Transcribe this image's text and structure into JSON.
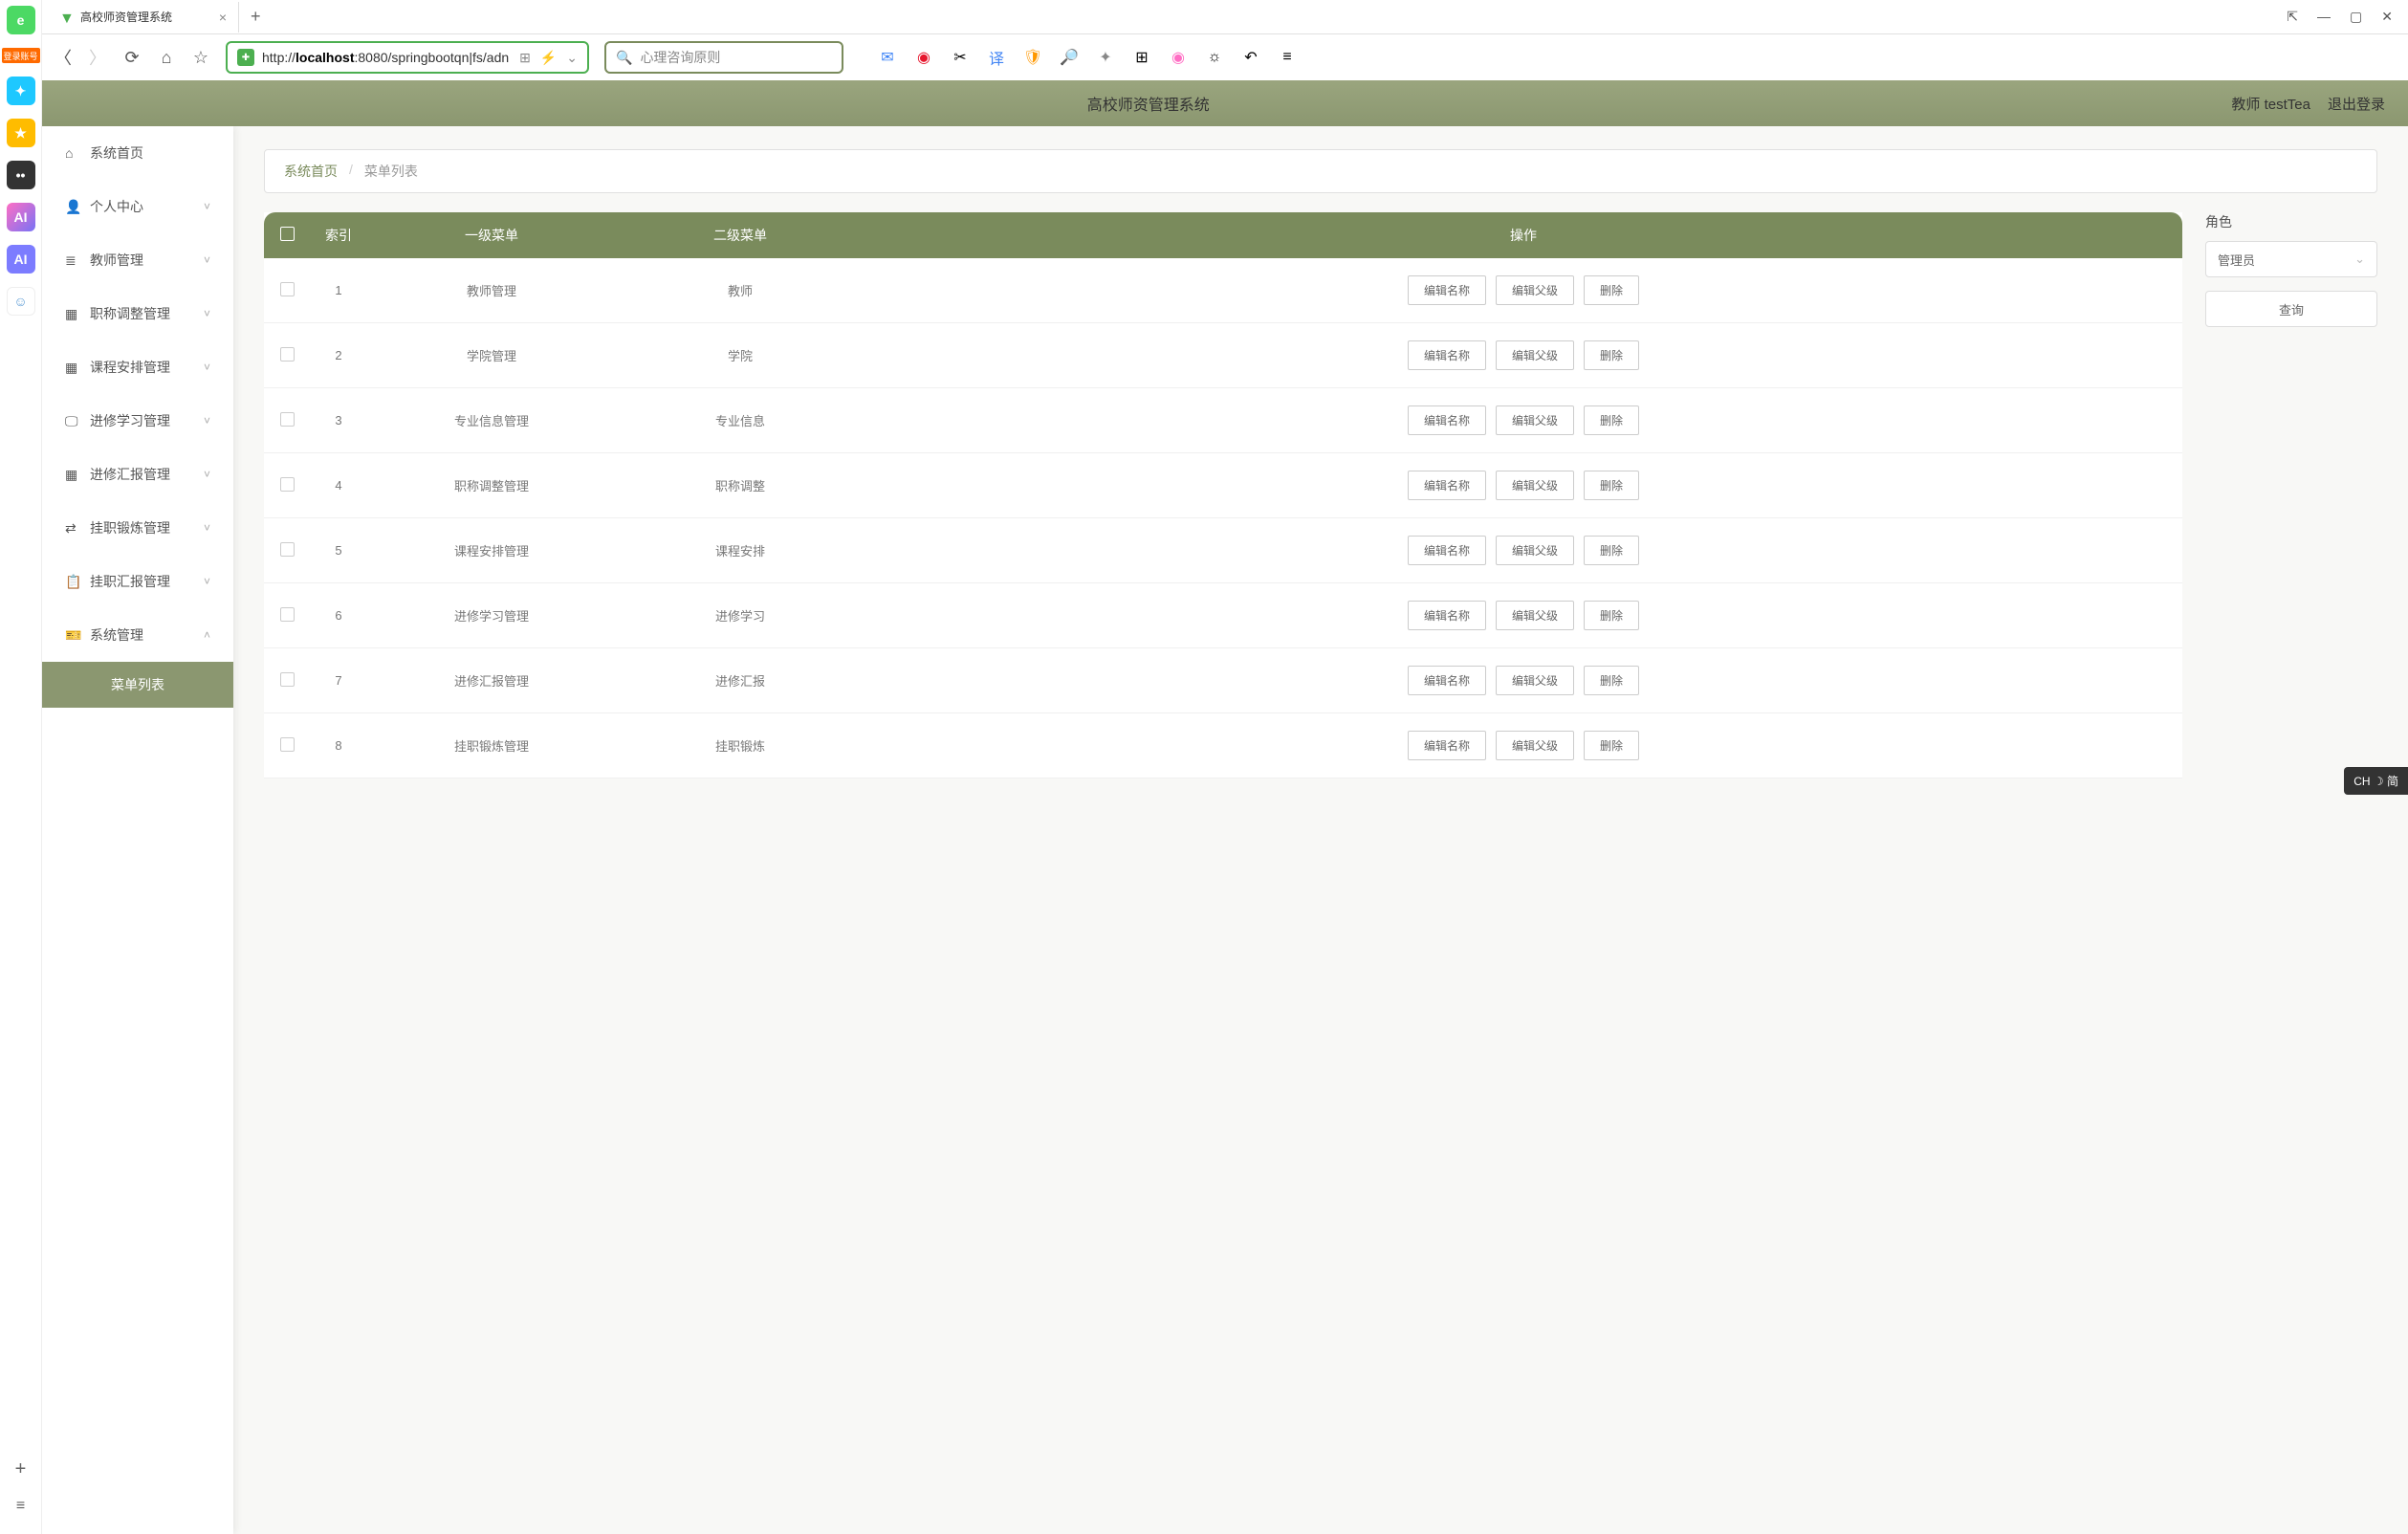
{
  "browser": {
    "tab_title": "高校师资管理系统",
    "url_prefix": "http://",
    "url_host": "localhost",
    "url_port_path": ":8080/springbootqn|fs/adn",
    "search_placeholder": "心理咨询原则",
    "login_badge": "登录账号"
  },
  "header": {
    "app_title": "高校师资管理系统",
    "role": "教师",
    "username": "testTea",
    "logout": "退出登录"
  },
  "sidemenu": {
    "items": [
      {
        "icon": "⌂",
        "label": "系统首页",
        "expandable": false
      },
      {
        "icon": "👤",
        "label": "个人中心",
        "expandable": true
      },
      {
        "icon": "≣",
        "label": "教师管理",
        "expandable": true
      },
      {
        "icon": "▦",
        "label": "职称调整管理",
        "expandable": true
      },
      {
        "icon": "▦",
        "label": "课程安排管理",
        "expandable": true
      },
      {
        "icon": "🖵",
        "label": "进修学习管理",
        "expandable": true
      },
      {
        "icon": "▦",
        "label": "进修汇报管理",
        "expandable": true
      },
      {
        "icon": "⇄",
        "label": "挂职锻炼管理",
        "expandable": true
      },
      {
        "icon": "📋",
        "label": "挂职汇报管理",
        "expandable": true
      },
      {
        "icon": "🎫",
        "label": "系统管理",
        "expandable": true,
        "open": true
      }
    ],
    "submenu_active": "菜单列表"
  },
  "breadcrumb": {
    "home": "系统首页",
    "current": "菜单列表"
  },
  "filter": {
    "label": "角色",
    "selected": "管理员",
    "query_btn": "查询"
  },
  "table": {
    "headers": {
      "index": "索引",
      "level1": "一级菜单",
      "level2": "二级菜单",
      "ops": "操作"
    },
    "op_labels": {
      "edit_name": "编辑名称",
      "edit_parent": "编辑父级",
      "delete": "删除"
    },
    "rows": [
      {
        "idx": "1",
        "l1": "教师管理",
        "l2": "教师"
      },
      {
        "idx": "2",
        "l1": "学院管理",
        "l2": "学院"
      },
      {
        "idx": "3",
        "l1": "专业信息管理",
        "l2": "专业信息"
      },
      {
        "idx": "4",
        "l1": "职称调整管理",
        "l2": "职称调整"
      },
      {
        "idx": "5",
        "l1": "课程安排管理",
        "l2": "课程安排"
      },
      {
        "idx": "6",
        "l1": "进修学习管理",
        "l2": "进修学习"
      },
      {
        "idx": "7",
        "l1": "进修汇报管理",
        "l2": "进修汇报"
      },
      {
        "idx": "8",
        "l1": "挂职锻炼管理",
        "l2": "挂职锻炼"
      }
    ]
  },
  "ime": "CH ☽ 简"
}
